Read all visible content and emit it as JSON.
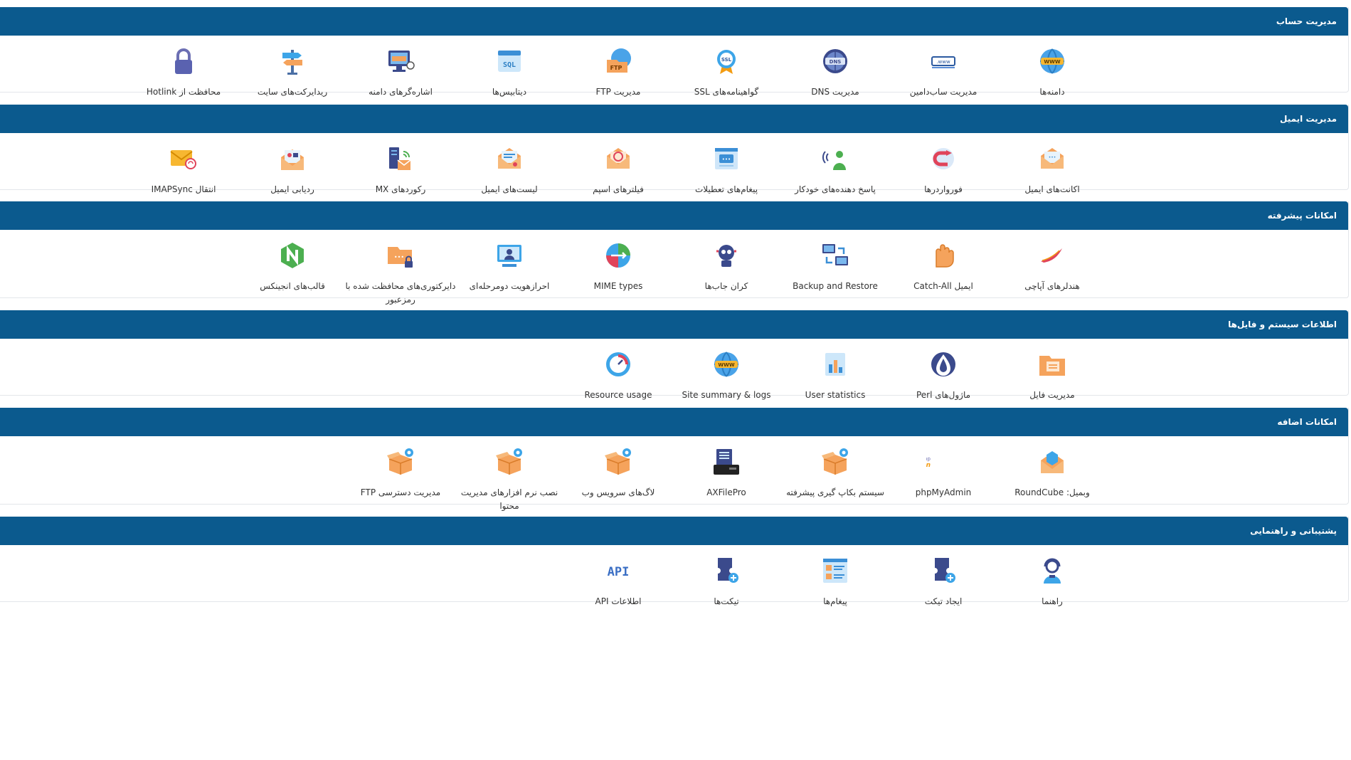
{
  "sections": [
    {
      "title": "مدیریت حساب",
      "items": [
        {
          "label": "دامنه‌ها",
          "icon": "globe-www-icon"
        },
        {
          "label": "مدیریت ساب‌دامین",
          "icon": "subdomain-icon"
        },
        {
          "label": "مدیریت DNS",
          "icon": "dns-globe-icon"
        },
        {
          "label": "گواهینامه‌های SSL",
          "icon": "ssl-badge-icon"
        },
        {
          "label": "مدیریت FTP",
          "icon": "ftp-folder-icon"
        },
        {
          "label": "دیتابیس‌ها",
          "icon": "sql-database-icon"
        },
        {
          "label": "اشاره‌گرهای دامنه",
          "icon": "domain-pointer-icon"
        },
        {
          "label": "ریدایرکت‌های سایت",
          "icon": "signpost-icon"
        },
        {
          "label": "محافظت از Hotlink",
          "icon": "padlock-icon"
        }
      ]
    },
    {
      "title": "مدیریت ایمیل",
      "items": [
        {
          "label": "اکانت‌های ایمیل",
          "icon": "email-account-icon"
        },
        {
          "label": "فورواردرها",
          "icon": "forwarder-icon"
        },
        {
          "label": "پاسخ دهنده‌های خودکار",
          "icon": "autoresponder-icon"
        },
        {
          "label": "پیغام‌های تعطیلات",
          "icon": "vacation-message-icon"
        },
        {
          "label": "فیلترهای اسپم",
          "icon": "spam-filter-icon"
        },
        {
          "label": "لیست‌های ایمیل",
          "icon": "mailing-list-icon"
        },
        {
          "label": "رکوردهای MX",
          "icon": "mx-records-icon"
        },
        {
          "label": "ردیابی ایمیل",
          "icon": "email-tracking-icon"
        },
        {
          "label": "انتقال IMAPSync",
          "icon": "imapsync-icon"
        }
      ]
    },
    {
      "title": "امکانات پیشرفته",
      "items": [
        {
          "label": "هندلرهای آپاچی",
          "icon": "apache-feather-icon"
        },
        {
          "label": "ایمیل Catch-All",
          "icon": "catch-all-glove-icon"
        },
        {
          "label": "Backup and Restore",
          "icon": "backup-restore-icon"
        },
        {
          "label": "کران جاب‌ها",
          "icon": "cron-robot-icon"
        },
        {
          "label": "MIME types",
          "icon": "mime-types-icon"
        },
        {
          "label": "احرازهویت دومرحله‌ای",
          "icon": "two-factor-icon"
        },
        {
          "label": "دایرکتوری‌های محافظت شده با رمزعبور",
          "icon": "protected-folder-icon"
        },
        {
          "label": "قالب‌های انجینکس",
          "icon": "nginx-icon"
        }
      ]
    },
    {
      "title": "اطلاعات سیستم و فایل‌ها",
      "items": [
        {
          "label": "مدیریت فایل",
          "icon": "file-manager-icon"
        },
        {
          "label": "ماژول‌های Perl",
          "icon": "perl-onion-icon"
        },
        {
          "label": "User statistics",
          "icon": "user-statistics-icon"
        },
        {
          "label": "Site summary & logs",
          "icon": "site-summary-icon"
        },
        {
          "label": "Resource usage",
          "icon": "resource-gauge-icon"
        }
      ]
    },
    {
      "title": "امکانات اضافه",
      "items": [
        {
          "label": "وبمیل: RoundCube",
          "icon": "roundcube-icon"
        },
        {
          "label": "phpMyAdmin",
          "icon": "phpmyadmin-icon"
        },
        {
          "label": "سیستم بکاپ گیری پیشرفته",
          "icon": "plugin-box-icon"
        },
        {
          "label": "AXFilePro",
          "icon": "axfilepro-icon"
        },
        {
          "label": "لاگ‌های سرویس وب",
          "icon": "plugin-box-icon"
        },
        {
          "label": "نصب نرم افزارهای مدیریت محتوا",
          "icon": "plugin-box-icon"
        },
        {
          "label": "مدیریت دسترسی FTP",
          "icon": "plugin-box-icon"
        }
      ]
    },
    {
      "title": "پشتیبانی و راهنمایی",
      "items": [
        {
          "label": "راهنما",
          "icon": "support-agent-icon"
        },
        {
          "label": "ایجاد تیکت",
          "icon": "create-ticket-icon"
        },
        {
          "label": "پیغام‌ها",
          "icon": "messages-icon"
        },
        {
          "label": "تیکت‌ها",
          "icon": "tickets-icon"
        },
        {
          "label": "اطلاعات API",
          "icon": "api-icon"
        }
      ]
    }
  ],
  "colors": {
    "header": "#0b5a8e",
    "text": "#333333",
    "border": "#e3e6ea"
  }
}
